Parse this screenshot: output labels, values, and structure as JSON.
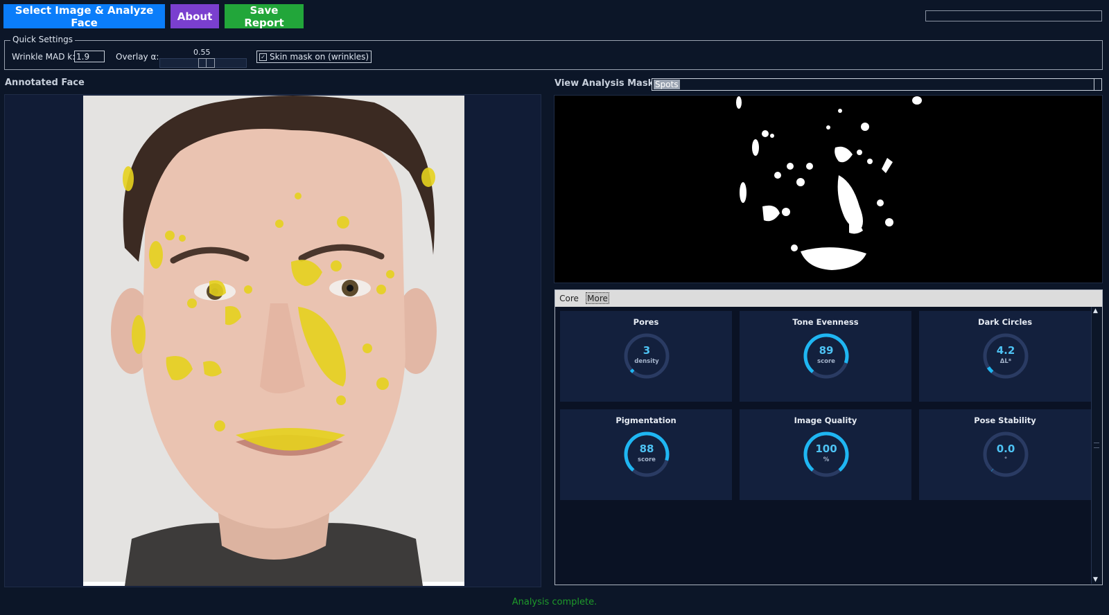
{
  "toolbar": {
    "analyze_label": "Select Image & Analyze Face",
    "about_label": "About",
    "save_label": "Save Report",
    "colors": {
      "analyze": "#0a7dfa",
      "about": "#7a3fcf",
      "save": "#22a63a"
    }
  },
  "quick_settings": {
    "legend": "Quick Settings",
    "wrinkle_label": "Wrinkle MAD k:",
    "wrinkle_value": "1.9",
    "overlay_label": "Overlay α:",
    "overlay_value": "0.55",
    "overlay_level": 0.55,
    "skin_mask_label": "Skin mask on (wrinkles)",
    "skin_mask_checked": true
  },
  "left_panel": {
    "title": "Annotated Face"
  },
  "right_panel": {
    "mask_label": "View Analysis Mask:",
    "mask_selected": "Spots"
  },
  "tabs": [
    {
      "label": "Core"
    },
    {
      "label": "More"
    }
  ],
  "metrics": [
    {
      "title": "Pores",
      "value": "3",
      "unit": "density",
      "fill": 0.03
    },
    {
      "title": "Tone Evenness",
      "value": "89",
      "unit": "score",
      "fill": 0.89
    },
    {
      "title": "Dark Circles",
      "value": "4.2",
      "unit": "ΔL*",
      "fill": 0.06
    },
    {
      "title": "Pigmentation",
      "value": "88",
      "unit": "score",
      "fill": 0.88
    },
    {
      "title": "Image Quality",
      "value": "100",
      "unit": "%",
      "fill": 1.0
    },
    {
      "title": "Pose Stability",
      "value": "0.0",
      "unit": "°",
      "fill": 0.0
    }
  ],
  "status": {
    "text": "Analysis complete.",
    "color": "#1e9a2a"
  },
  "accent": "#1fb6f2"
}
